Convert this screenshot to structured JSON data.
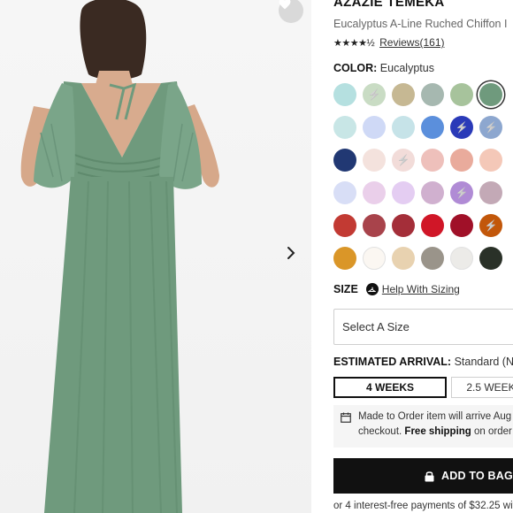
{
  "product": {
    "brand": "AZAZIE TEMEKA",
    "subtitle": "Eucalyptus A-Line Ruched Chiffon I",
    "stars_text": "★★★★½",
    "reviews_label": "Reviews(161)"
  },
  "color": {
    "label": "COLOR:",
    "selected_name": "Eucalyptus",
    "swatches": [
      {
        "hex": "#b5e0e0",
        "bolt": false
      },
      {
        "hex": "#c9dcc4",
        "bolt": true
      },
      {
        "hex": "#c6b893",
        "bolt": false
      },
      {
        "hex": "#a6b8b0",
        "bolt": false
      },
      {
        "hex": "#a7c39c",
        "bolt": false
      },
      {
        "hex": "#6f9a7d",
        "bolt": false,
        "selected": true
      },
      {
        "hex": "#c8e6e6",
        "bolt": false
      },
      {
        "hex": "#cfd9f6",
        "bolt": false
      },
      {
        "hex": "#c6e3e8",
        "bolt": false
      },
      {
        "hex": "#5b8fdc",
        "bolt": false
      },
      {
        "hex": "#2a3ab8",
        "bolt": true
      },
      {
        "hex": "#8da7cf",
        "bolt": true
      },
      {
        "hex": "#213873",
        "bolt": false
      },
      {
        "hex": "#f4e2dd",
        "bolt": false
      },
      {
        "hex": "#f2dcd9",
        "bolt": true
      },
      {
        "hex": "#eec0bb",
        "bolt": false
      },
      {
        "hex": "#e9ab9c",
        "bolt": false
      },
      {
        "hex": "#f4c8b8",
        "bolt": false
      },
      {
        "hex": "#d8def6",
        "bolt": false
      },
      {
        "hex": "#eacfea",
        "bolt": false
      },
      {
        "hex": "#e4cdf2",
        "bolt": false
      },
      {
        "hex": "#d0b0cf",
        "bolt": false
      },
      {
        "hex": "#b08bd5",
        "bolt": true
      },
      {
        "hex": "#c3a9b6",
        "bolt": false
      },
      {
        "hex": "#c23a33",
        "bolt": false
      },
      {
        "hex": "#a8434b",
        "bolt": false
      },
      {
        "hex": "#a42e39",
        "bolt": false
      },
      {
        "hex": "#d01627",
        "bolt": false
      },
      {
        "hex": "#a01028",
        "bolt": false
      },
      {
        "hex": "#c2570a",
        "bolt": true
      },
      {
        "hex": "#da9628",
        "bolt": false
      },
      {
        "hex": "#fbf7f2",
        "bolt": false
      },
      {
        "hex": "#e8d2b0",
        "bolt": false
      },
      {
        "hex": "#9a948a",
        "bolt": false
      },
      {
        "hex": "#ecebe8",
        "bolt": false
      },
      {
        "hex": "#2a3128",
        "bolt": false
      }
    ]
  },
  "size": {
    "label": "SIZE",
    "help_label": "Help With Sizing",
    "select_placeholder": "Select A Size"
  },
  "arrival": {
    "label": "ESTIMATED ARRIVAL:",
    "value": "Standard (N",
    "option_selected": "4 WEEKS",
    "option_other": "2.5 WEEK"
  },
  "note": {
    "line1": "Made to Order item will arrive Aug",
    "line2_prefix": "checkout. ",
    "line2_bold": "Free shipping",
    "line2_suffix": " on order"
  },
  "cart": {
    "add_label": "ADD TO BAG"
  },
  "installments": "or 4 interest-free payments of $32.25 wit",
  "colors": {
    "accent": "#111111",
    "dress": "#6f9a7d"
  }
}
